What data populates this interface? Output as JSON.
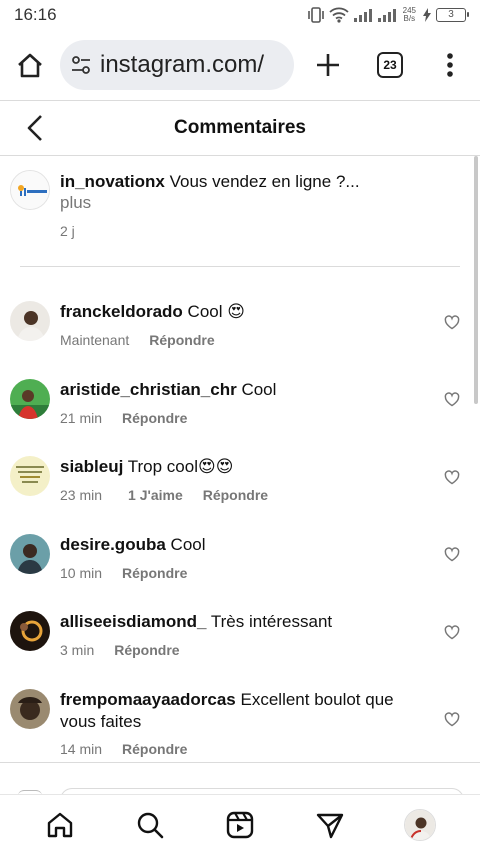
{
  "status_bar": {
    "time": "16:16",
    "net_speed_value": "245",
    "net_speed_unit": "B/s",
    "battery": "3"
  },
  "browser": {
    "url": "instagram.com/",
    "tab_count": "23"
  },
  "page": {
    "title": "Commentaires"
  },
  "caption": {
    "username": "in_novationx",
    "text": "Vous vendez en ligne ?...",
    "more": "plus",
    "time": "2 j"
  },
  "comments": [
    {
      "username": "franckeldorado",
      "text": "Cool 😍",
      "time": "Maintenant",
      "likes": "",
      "reply": "Répondre"
    },
    {
      "username": "aristide_christian_chr",
      "text": "Cool",
      "time": "21 min",
      "likes": "",
      "reply": "Répondre"
    },
    {
      "username": "siableuj",
      "text": "Trop cool😍😍",
      "time": "23 min",
      "likes": "1 J'aime",
      "reply": "Répondre"
    },
    {
      "username": "desire.gouba",
      "text": "Cool",
      "time": "10 min",
      "likes": "",
      "reply": "Répondre"
    },
    {
      "username": "alliseeisdiamond_",
      "text": "Très intéressant",
      "time": "3 min",
      "likes": "",
      "reply": "Répondre"
    },
    {
      "username": "frempomaayaadorcas",
      "text": "Excellent boulot que vous faites",
      "time": "14 min",
      "likes": "",
      "reply": "Répondre"
    }
  ],
  "colors": {
    "text_primary": "#111111",
    "text_secondary": "#777777",
    "divider": "#dbdbdb",
    "url_pill": "#ebedf1"
  }
}
